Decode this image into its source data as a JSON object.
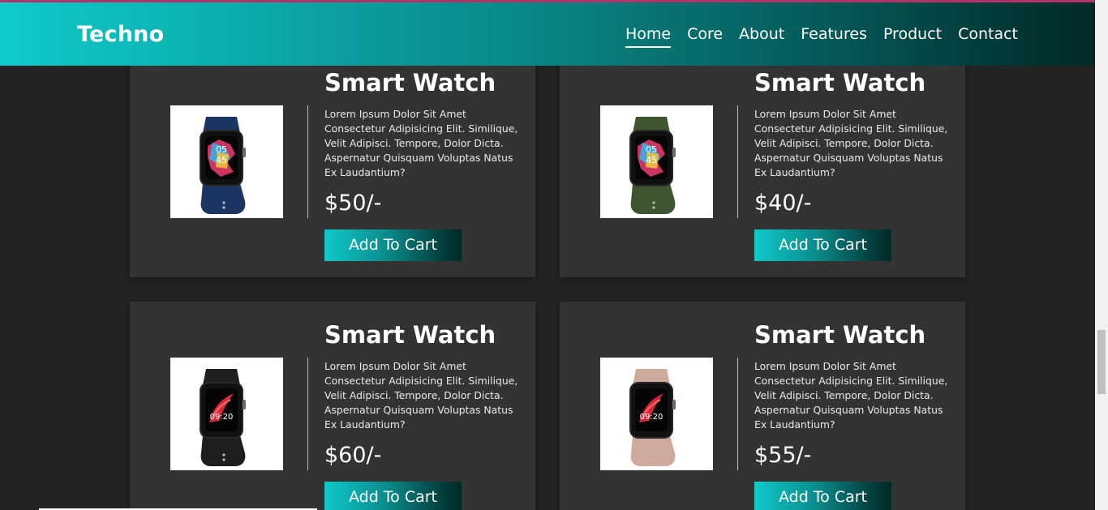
{
  "nav": {
    "brand": "Techno",
    "items": [
      {
        "label": "Home",
        "active": true
      },
      {
        "label": "Core",
        "active": false
      },
      {
        "label": "About",
        "active": false
      },
      {
        "label": "Features",
        "active": false
      },
      {
        "label": "Product",
        "active": false
      },
      {
        "label": "Contact",
        "active": false
      }
    ]
  },
  "colors": {
    "accent_start": "#0fcaca",
    "accent_end": "#012826",
    "page_bg": "#232323",
    "card_bg": "#333333",
    "top_line": "#b0336a"
  },
  "products": [
    {
      "title": "Smart Watch",
      "description": "Lorem Ipsum Dolor Sit Amet Consectetur Adipisicing Elit. Similique, Velit Adipisci. Tempore, Dolor Dicta. Aspernatur Quisquam Voluptas Natus Ex Laudantium?",
      "price": "$50/-",
      "button": "Add To Cart",
      "image": "smart-watch-navy-blue",
      "strap_color": "#1d3563"
    },
    {
      "title": "Smart Watch",
      "description": "Lorem Ipsum Dolor Sit Amet Consectetur Adipisicing Elit. Similique, Velit Adipisci. Tempore, Dolor Dicta. Aspernatur Quisquam Voluptas Natus Ex Laudantium?",
      "price": "$40/-",
      "button": "Add To Cart",
      "image": "smart-watch-olive-green",
      "strap_color": "#3d5530"
    },
    {
      "title": "Smart Watch",
      "description": "Lorem Ipsum Dolor Sit Amet Consectetur Adipisicing Elit. Similique, Velit Adipisci. Tempore, Dolor Dicta. Aspernatur Quisquam Voluptas Natus Ex Laudantium?",
      "price": "$60/-",
      "button": "Add To Cart",
      "image": "smart-watch-black",
      "strap_color": "#1e1e1e"
    },
    {
      "title": "Smart Watch",
      "description": "Lorem Ipsum Dolor Sit Amet Consectetur Adipisicing Elit. Similique, Velit Adipisci. Tempore, Dolor Dicta. Aspernatur Quisquam Voluptas Natus Ex Laudantium?",
      "price": "$55/-",
      "button": "Add To Cart",
      "image": "smart-watch-rose-pink",
      "strap_color": "#cfa99c"
    }
  ]
}
